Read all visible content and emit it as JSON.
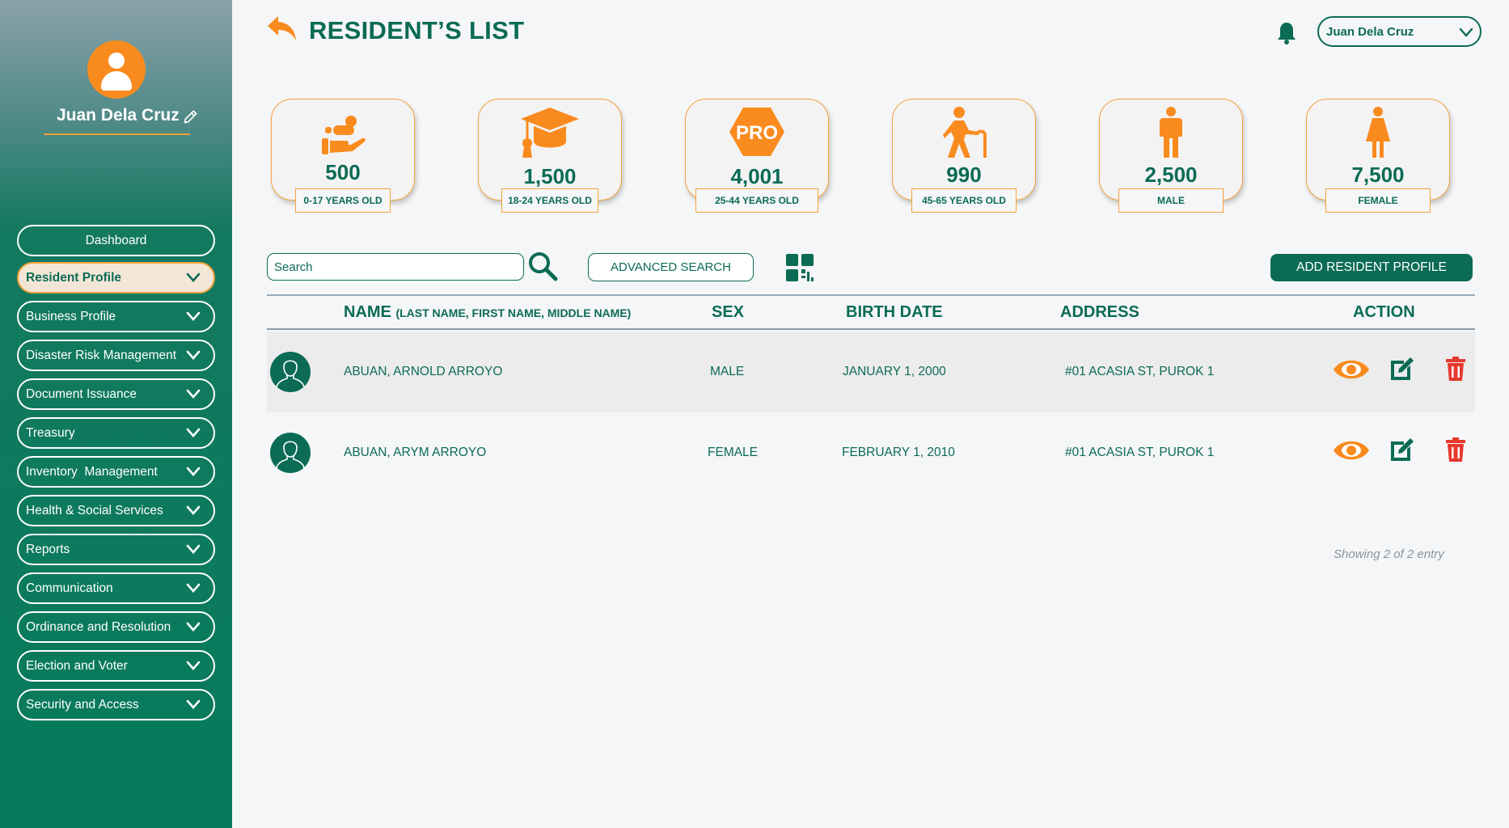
{
  "sidebar": {
    "user_name": "Juan Dela Cruz",
    "items": [
      {
        "label": "Dashboard"
      },
      {
        "label": "Resident Profile"
      },
      {
        "label": "Business Profile"
      },
      {
        "label": "Disaster Risk Management"
      },
      {
        "label": "Document Issuance"
      },
      {
        "label": "Treasury"
      },
      {
        "label": "Inventory  Management"
      },
      {
        "label": "Health & Social Services"
      },
      {
        "label": "Reports"
      },
      {
        "label": "Communication"
      },
      {
        "label": "Ordinance and Resolution"
      },
      {
        "label": "Election and Voter"
      },
      {
        "label": "Security and Access"
      }
    ],
    "active_item": "Resident Profile"
  },
  "header": {
    "title": "RESIDENT’S LIST",
    "user_select": "Juan Dela Cruz"
  },
  "stats": [
    {
      "value": "500",
      "label": "0-17 YEARS OLD",
      "icon": "child-care-icon"
    },
    {
      "value": "1,500",
      "label": "18-24 YEARS OLD",
      "icon": "graduation-cap-icon"
    },
    {
      "value": "4,001",
      "label": "25-44 YEARS OLD",
      "icon": "pro-badge-icon"
    },
    {
      "value": "990",
      "label": "45-65 YEARS OLD",
      "icon": "elderly-icon"
    },
    {
      "value": "2,500",
      "label": "MALE",
      "icon": "male-icon"
    },
    {
      "value": "7,500",
      "label": "FEMALE",
      "icon": "female-icon"
    }
  ],
  "toolbar": {
    "search_placeholder": "Search",
    "advanced_search_label": "ADVANCED SEARCH",
    "add_button_label": "ADD RESIDENT PROFILE"
  },
  "table": {
    "headers": {
      "name": "NAME",
      "name_note": "(LAST NAME, FIRST NAME, MIDDLE NAME)",
      "sex": "SEX",
      "birth_date": "BIRTH DATE",
      "address": "ADDRESS",
      "action": "ACTION"
    },
    "rows": [
      {
        "name": "ABUAN, ARNOLD ARROYO",
        "sex": "MALE",
        "birth_date": "JANUARY 1, 2000",
        "address": "#01 ACASIA ST, PUROK 1"
      },
      {
        "name": "ABUAN, ARYM ARROYO",
        "sex": "FEMALE",
        "birth_date": "FEBRUARY 1, 2010",
        "address": "#01 ACASIA ST, PUROK 1"
      }
    ],
    "footer": "Showing 2 of 2 entry"
  },
  "colors": {
    "primary": "#0b6b55",
    "accent": "#f98b1e",
    "danger": "#e5392e"
  }
}
